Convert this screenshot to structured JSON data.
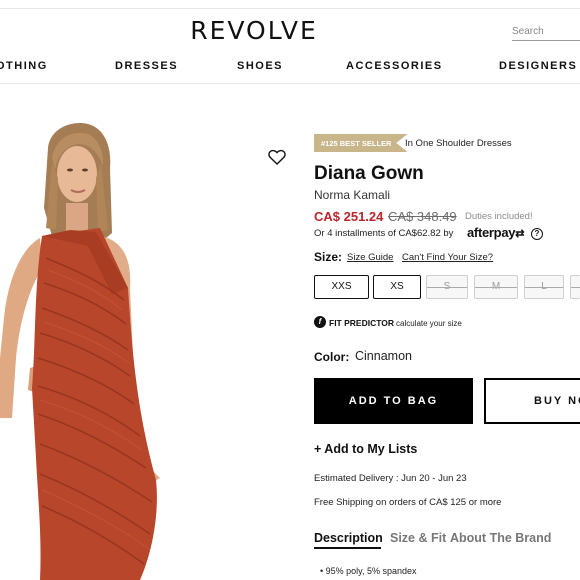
{
  "header": {
    "logo": "REVOLVE",
    "search_placeholder": "Search",
    "nav": [
      "OTHING",
      "DRESSES",
      "SHOES",
      "ACCESSORIES",
      "DESIGNERS"
    ]
  },
  "product": {
    "badge": "#125 BEST SELLER",
    "badge_category": "In One Shoulder Dresses",
    "title": "Diana Gown",
    "brand": "Norma Kamali",
    "price": "CA$ 251.24",
    "old_price": "CA$ 348.49",
    "duties": "Duties included!",
    "installments": "Or 4 installments of CA$62.82 by",
    "afterpay": "afterpay",
    "info_icon": "?",
    "size_label": "Size:",
    "size_guide": "Size Guide",
    "size_find": "Can't Find Your Size?",
    "sizes": [
      {
        "label": "XXS",
        "available": true
      },
      {
        "label": "XS",
        "available": true
      },
      {
        "label": "S",
        "available": false
      },
      {
        "label": "M",
        "available": false
      },
      {
        "label": "L",
        "available": false
      },
      {
        "label": "",
        "available": false
      }
    ],
    "fit_predictor": "FIT PREDICTOR",
    "fit_predictor_sub": "calculate your size",
    "color_label": "Color:",
    "color_value": "Cinnamon",
    "add_to_bag": "ADD TO BAG",
    "buy_now": "BUY NO",
    "add_to_lists": "+ Add to My Lists",
    "delivery": "Estimated Delivery : Jun 20 - Jun 23",
    "shipping": "Free Shipping on orders of CA$ 125 or more",
    "tabs": [
      "Description",
      "Size & Fit",
      "About The Brand"
    ],
    "active_tab": 0,
    "description_bullet": "•  95% poly, 5% spandex"
  },
  "colors": {
    "accent_red": "#b9262c",
    "badge_gold": "#c9b58a",
    "dress": "#b8462a",
    "skin": "#e3b28e",
    "hair": "#a57d55"
  },
  "icons": {
    "wishlist": "heart-icon",
    "fit": "fit-predictor-icon",
    "info": "info-icon"
  }
}
